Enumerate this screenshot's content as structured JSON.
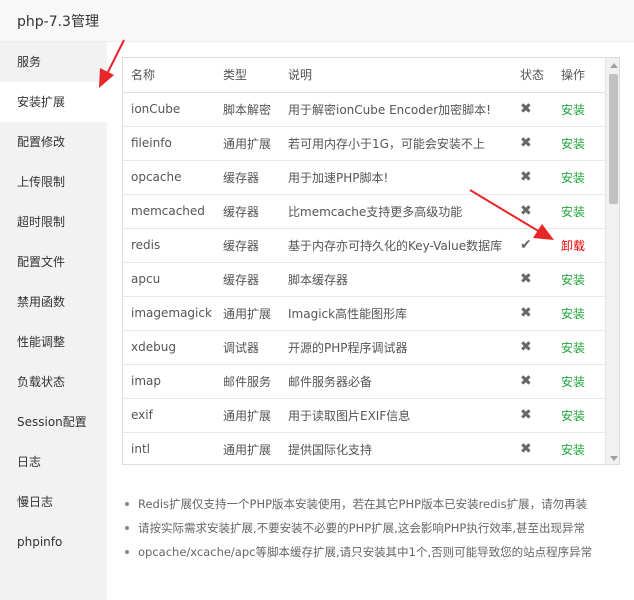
{
  "window": {
    "title": "php-7.3管理"
  },
  "sidebar": {
    "items": [
      {
        "label": "服务",
        "active": false
      },
      {
        "label": "安装扩展",
        "active": true
      },
      {
        "label": "配置修改",
        "active": false
      },
      {
        "label": "上传限制",
        "active": false
      },
      {
        "label": "超时限制",
        "active": false
      },
      {
        "label": "配置文件",
        "active": false
      },
      {
        "label": "禁用函数",
        "active": false
      },
      {
        "label": "性能调整",
        "active": false
      },
      {
        "label": "负载状态",
        "active": false
      },
      {
        "label": "Session配置",
        "active": false
      },
      {
        "label": "日志",
        "active": false
      },
      {
        "label": "慢日志",
        "active": false
      },
      {
        "label": "phpinfo",
        "active": false
      }
    ]
  },
  "table": {
    "headers": {
      "name": "名称",
      "type": "类型",
      "desc": "说明",
      "status": "状态",
      "op": "操作"
    },
    "rows": [
      {
        "name": "ionCube",
        "type": "脚本解密",
        "desc": "用于解密ionCube Encoder加密脚本!",
        "status": "✖",
        "op": "安装"
      },
      {
        "name": "fileinfo",
        "type": "通用扩展",
        "desc": "若可用内存小于1G，可能会安装不上",
        "status": "✖",
        "op": "安装"
      },
      {
        "name": "opcache",
        "type": "缓存器",
        "desc": "用于加速PHP脚本!",
        "status": "✖",
        "op": "安装"
      },
      {
        "name": "memcached",
        "type": "缓存器",
        "desc": "比memcache支持更多高级功能",
        "status": "✖",
        "op": "安装"
      },
      {
        "name": "redis",
        "type": "缓存器",
        "desc": "基于内存亦可持久化的Key-Value数据库",
        "status": "✔",
        "op": "卸载"
      },
      {
        "name": "apcu",
        "type": "缓存器",
        "desc": "脚本缓存器",
        "status": "✖",
        "op": "安装"
      },
      {
        "name": "imagemagick",
        "type": "通用扩展",
        "desc": "Imagick高性能图形库",
        "status": "✖",
        "op": "安装"
      },
      {
        "name": "xdebug",
        "type": "调试器",
        "desc": "开源的PHP程序调试器",
        "status": "✖",
        "op": "安装"
      },
      {
        "name": "imap",
        "type": "邮件服务",
        "desc": "邮件服务器必备",
        "status": "✖",
        "op": "安装"
      },
      {
        "name": "exif",
        "type": "通用扩展",
        "desc": "用于读取图片EXIF信息",
        "status": "✖",
        "op": "安装"
      },
      {
        "name": "intl",
        "type": "通用扩展",
        "desc": "提供国际化支持",
        "status": "✖",
        "op": "安装"
      }
    ]
  },
  "notes": [
    "Redis扩展仅支持一个PHP版本安装使用，若在其它PHP版本已安装redis扩展，请勿再装",
    "请按实际需求安装扩展,不要安装不必要的PHP扩展,这会影响PHP执行效率,甚至出现异常",
    "opcache/xcache/apc等脚本缓存扩展,请只安装其中1个,否则可能导致您的站点程序异常"
  ],
  "colors": {
    "install": "#20a53a",
    "uninstall": "#e00000",
    "arrow": "#e8262a"
  }
}
